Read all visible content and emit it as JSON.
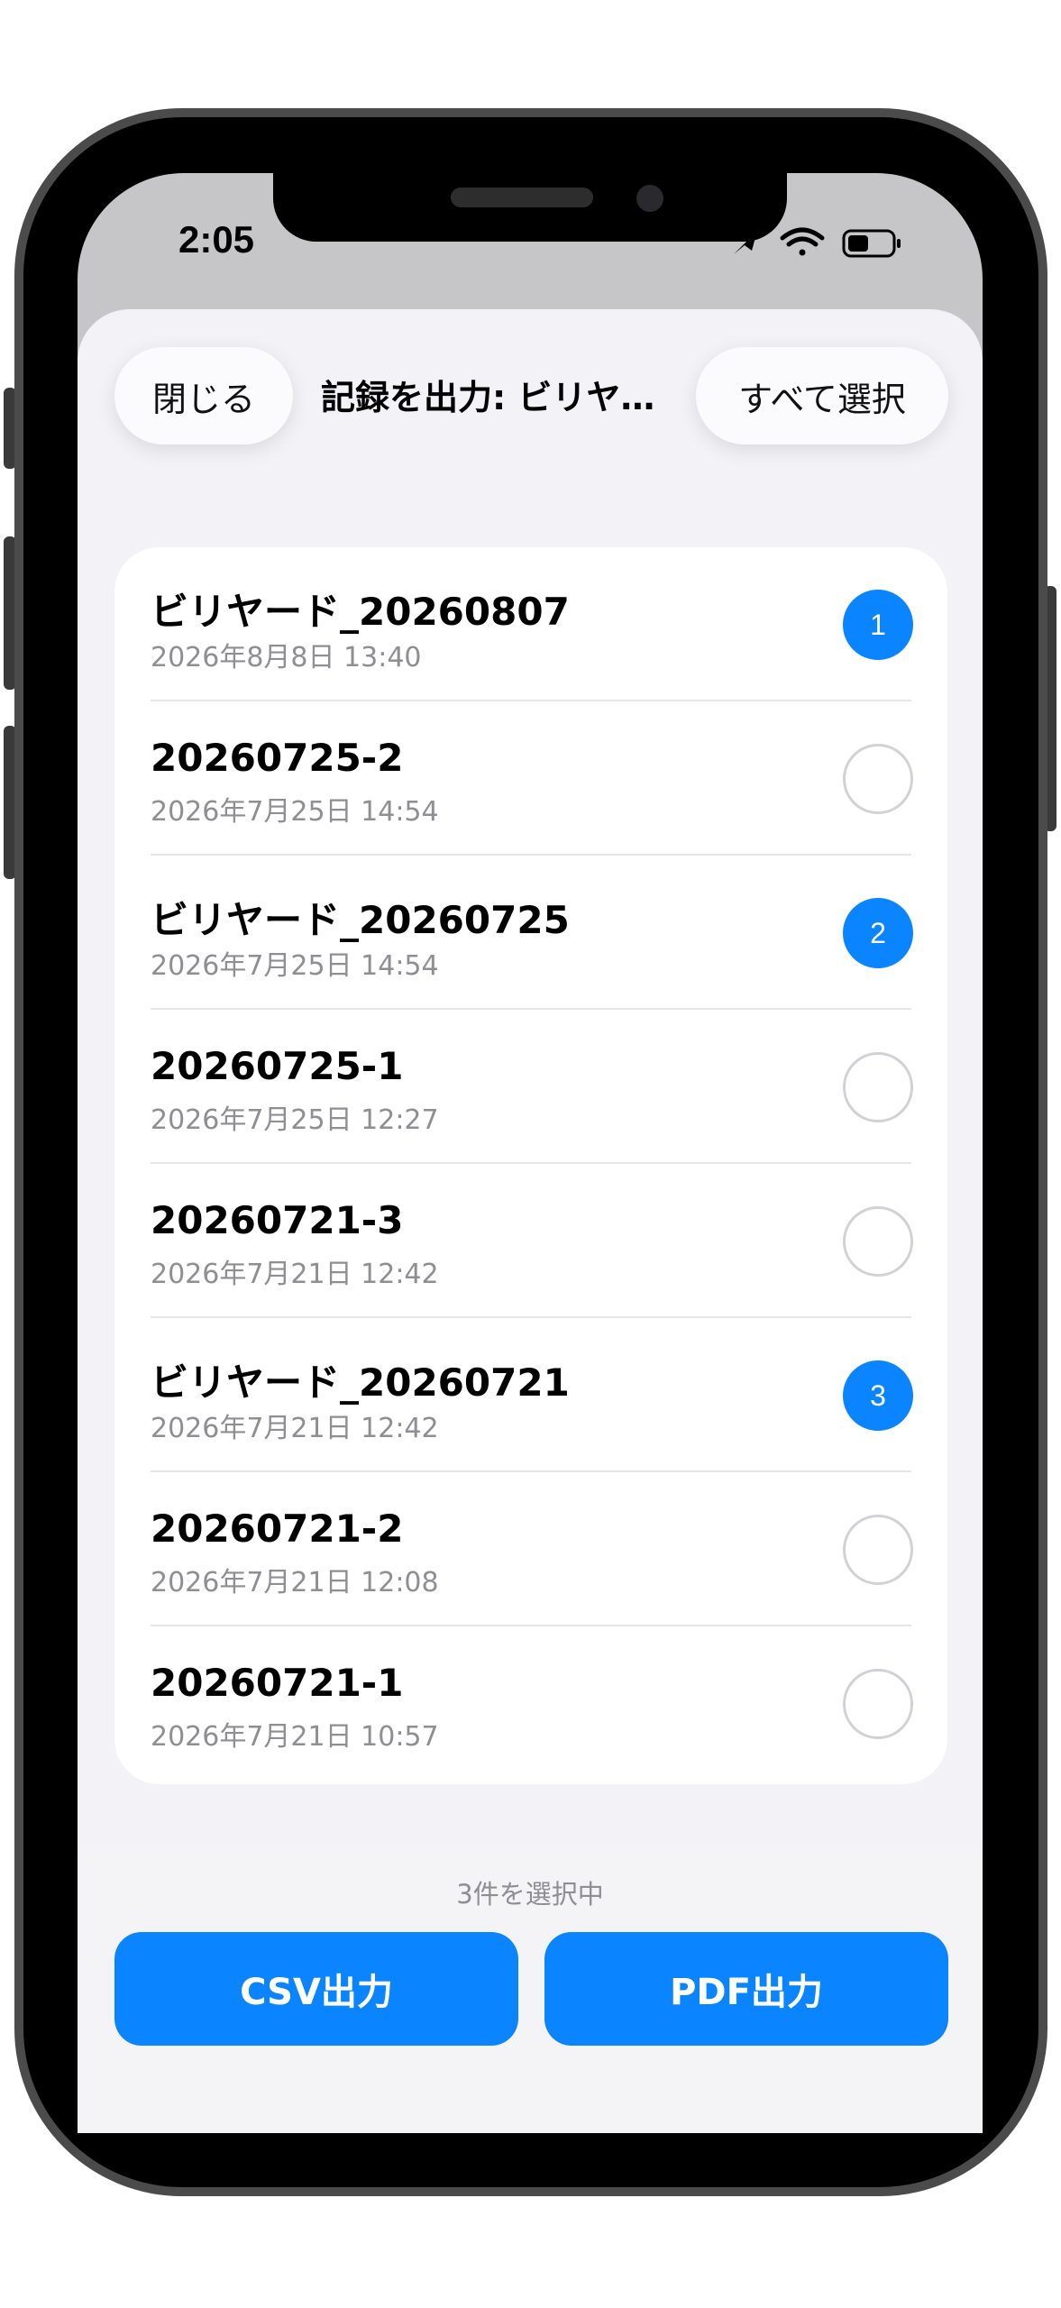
{
  "status_bar": {
    "time": "2:05"
  },
  "header": {
    "close_label": "閉じる",
    "title": "記録を出力: ビリヤ…",
    "select_all_label": "すべて選択"
  },
  "records": [
    {
      "title": "ビリヤード_20260807",
      "date": "2026年8月8日 13:40",
      "selection": "1"
    },
    {
      "title": "20260725-2",
      "date": "2026年7月25日 14:54",
      "selection": ""
    },
    {
      "title": "ビリヤード_20260725",
      "date": "2026年7月25日 14:54",
      "selection": "2"
    },
    {
      "title": "20260725-1",
      "date": "2026年7月25日 12:27",
      "selection": ""
    },
    {
      "title": "20260721-3",
      "date": "2026年7月21日 12:42",
      "selection": ""
    },
    {
      "title": "ビリヤード_20260721",
      "date": "2026年7月21日 12:42",
      "selection": "3"
    },
    {
      "title": "20260721-2",
      "date": "2026年7月21日 12:08",
      "selection": ""
    },
    {
      "title": "20260721-1",
      "date": "2026年7月21日 10:57",
      "selection": ""
    }
  ],
  "footer": {
    "selected_count": "3件を選択中",
    "csv_label": "CSV出力",
    "pdf_label": "PDF出力"
  },
  "colors": {
    "accent": "#0a84ff",
    "sheet_bg": "#f2f2f7",
    "secondary_text": "#8e8e93"
  }
}
